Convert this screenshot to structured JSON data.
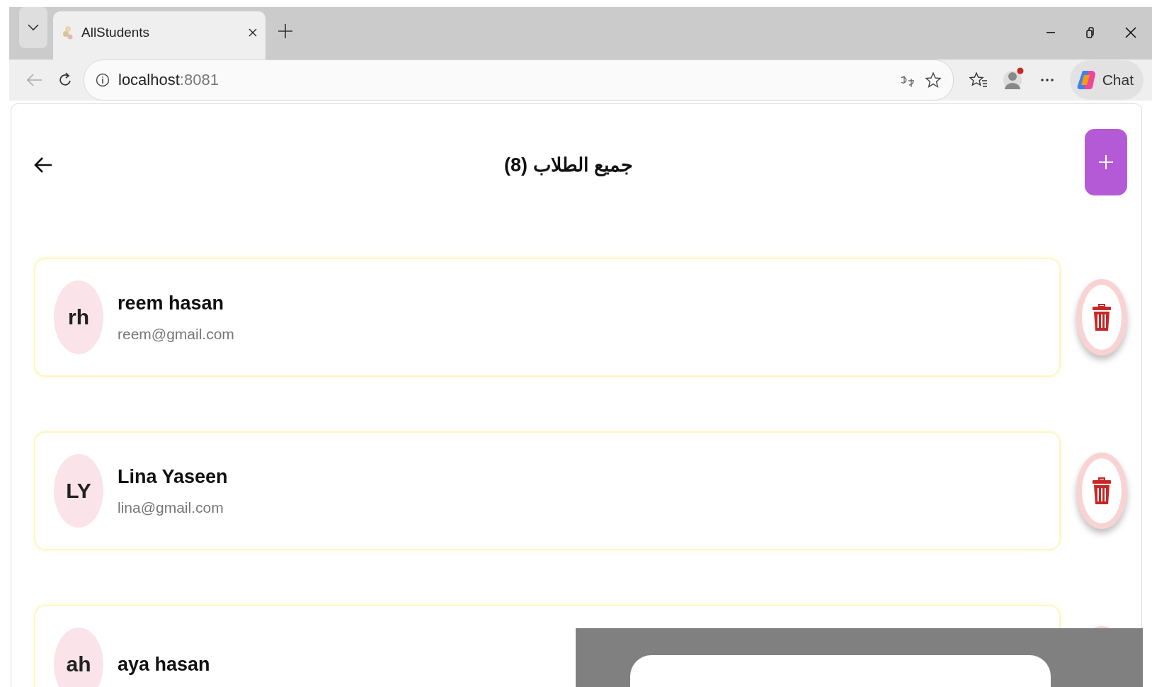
{
  "browser": {
    "tabs": [
      {
        "title": "AllStudents",
        "selected": true
      }
    ],
    "address": {
      "host": "localhost",
      "port": ":8081"
    },
    "chat_label": "Chat"
  },
  "page": {
    "title": "جميع الطلاب (8)",
    "students": [
      {
        "initials": "rh",
        "name": "reem hasan",
        "email": "reem@gmail.com"
      },
      {
        "initials": "LY",
        "name": "Lina Yaseen",
        "email": "lina@gmail.com"
      },
      {
        "initials": "ah",
        "name": "aya hasan"
      }
    ]
  },
  "overlay": {
    "visible": true
  }
}
